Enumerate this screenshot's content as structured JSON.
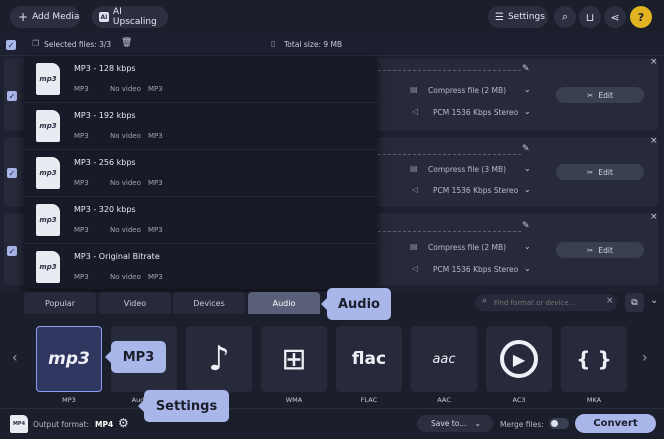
{
  "topbar": {
    "add_media": "Add Media",
    "ai_upscaling": "AI Upscaling",
    "settings": "Settings"
  },
  "subbar": {
    "selected_files": "Selected files: 3/3",
    "total_size": "Total size: 9 MB"
  },
  "file_rows": [
    {
      "compress": "Compress file (2 MB)",
      "audio": "PCM 1536 Kbps Stereo",
      "edit": "Edit"
    },
    {
      "compress": "Compress file (3 MB)",
      "audio": "PCM 1536 Kbps Stereo",
      "edit": "Edit"
    },
    {
      "compress": "Compress file (2 MB)",
      "audio": "PCM 1536 Kbps Stereo",
      "edit": "Edit"
    }
  ],
  "presets": [
    {
      "title": "MP3 - 128 kbps",
      "format": "MP3",
      "video": "No video",
      "codec": "MP3",
      "icon_text": "mp3"
    },
    {
      "title": "MP3 - 192 kbps",
      "format": "MP3",
      "video": "No video",
      "codec": "MP3",
      "icon_text": "mp3"
    },
    {
      "title": "MP3 - 256 kbps",
      "format": "MP3",
      "video": "No video",
      "codec": "MP3",
      "icon_text": "mp3"
    },
    {
      "title": "MP3 - 320 kbps",
      "format": "MP3",
      "video": "No video",
      "codec": "MP3",
      "icon_text": "mp3"
    },
    {
      "title": "MP3 - Original Bitrate",
      "format": "MP3",
      "video": "No video",
      "codec": "MP3",
      "icon_text": "mp3"
    }
  ],
  "tabs": [
    "Popular",
    "Video",
    "Devices",
    "Audio"
  ],
  "search": {
    "placeholder": "Find format or device..."
  },
  "formats": [
    {
      "label": "MP3",
      "glyph": "mp3"
    },
    {
      "label": "Audio fi",
      "glyph": ""
    },
    {
      "label": "",
      "glyph": "♪"
    },
    {
      "label": "WMA",
      "glyph": "⊞"
    },
    {
      "label": "FLAC",
      "glyph": "flac"
    },
    {
      "label": "AAC",
      "glyph": "aac"
    },
    {
      "label": "AC3",
      "glyph": "▶"
    },
    {
      "label": "MKA",
      "glyph": "{ }"
    }
  ],
  "callouts": {
    "audio": "Audio",
    "mp3": "MP3",
    "settings": "Settings"
  },
  "bottombar": {
    "output_label": "Output format:",
    "output_value": "MP4",
    "save_to": "Save to...",
    "merge_files": "Merge files:",
    "convert": "Convert"
  },
  "colors": {
    "accent": "#a9b6ea",
    "background": "#1e2130",
    "panel": "#262a3a"
  }
}
